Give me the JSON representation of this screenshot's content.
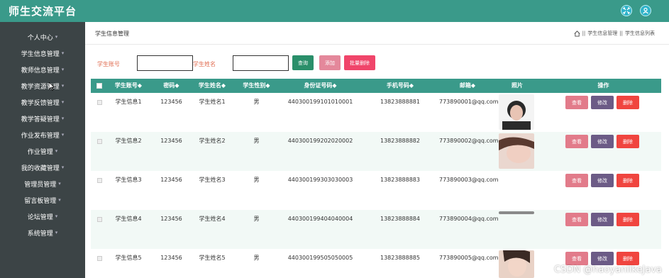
{
  "app": {
    "title": "师生交流平台"
  },
  "topbar": {
    "icons": [
      "fullscreen-icon",
      "user-icon"
    ]
  },
  "sidebar": {
    "items": [
      {
        "label": "个人中心"
      },
      {
        "label": "学生信息管理"
      },
      {
        "label": "教师信息管理"
      },
      {
        "label": "教学资源管理"
      },
      {
        "label": "教学反馈管理"
      },
      {
        "label": "教学答疑管理"
      },
      {
        "label": "作业发布管理"
      },
      {
        "label": "作业管理"
      },
      {
        "label": "我的收藏管理"
      },
      {
        "label": "管理员管理"
      },
      {
        "label": "留言板管理"
      },
      {
        "label": "论坛管理"
      },
      {
        "label": "系统管理"
      }
    ]
  },
  "page": {
    "title": "学生信息管理",
    "breadcrumb": [
      "学生信息管理",
      "学生信息列表"
    ],
    "breadcrumb_sep": "||"
  },
  "filters": {
    "student_account_label": "学生账号",
    "student_account_value": "",
    "student_name_label": "学生姓名",
    "student_name_value": "",
    "query_button": "查询",
    "add_button": "添加",
    "batch_delete_button": "批量删除"
  },
  "table": {
    "headers": [
      "学生账号",
      "密码",
      "学生姓名",
      "学生性别",
      "身份证号码",
      "手机号码",
      "邮箱",
      "照片",
      "操作"
    ],
    "sort_marker": "◆",
    "rows": [
      {
        "account": "学生信息1",
        "password": "123456",
        "name": "学生姓名1",
        "gender": "男",
        "id_card": "440300199101010001",
        "phone": "13823888881",
        "email": "773890001@qq.com"
      },
      {
        "account": "学生信息2",
        "password": "123456",
        "name": "学生姓名2",
        "gender": "男",
        "id_card": "440300199202020002",
        "phone": "13823888882",
        "email": "773890002@qq.com"
      },
      {
        "account": "学生信息3",
        "password": "123456",
        "name": "学生姓名3",
        "gender": "男",
        "id_card": "440300199303030003",
        "phone": "13823888883",
        "email": "773890003@qq.com"
      },
      {
        "account": "学生信息4",
        "password": "123456",
        "name": "学生姓名4",
        "gender": "男",
        "id_card": "440300199404040004",
        "phone": "13823888884",
        "email": "773890004@qq.com"
      },
      {
        "account": "学生信息5",
        "password": "123456",
        "name": "学生姓名5",
        "gender": "男",
        "id_card": "440300199505050005",
        "phone": "13823888885",
        "email": "773890005@qq.com"
      }
    ],
    "actions": {
      "view": "查看",
      "edit": "修改",
      "delete": "删除"
    }
  },
  "watermark": "CSDN @haoyanlikeJava",
  "colors": {
    "primary": "#3a9a8a",
    "sidebar_bg": "#3c4446",
    "danger": "#f0453f",
    "edit": "#6c5b86",
    "view": "#e27b8a"
  }
}
